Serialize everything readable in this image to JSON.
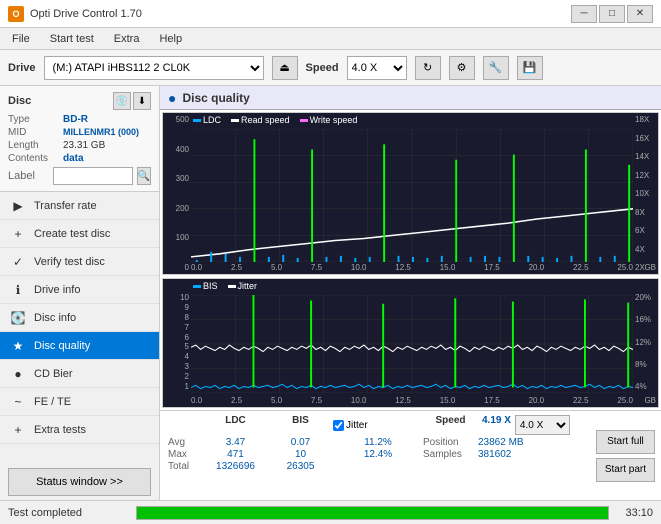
{
  "titlebar": {
    "title": "Opti Drive Control 1.70",
    "icon_label": "O",
    "minimize": "─",
    "maximize": "□",
    "close": "✕"
  },
  "menubar": {
    "items": [
      "File",
      "Start test",
      "Extra",
      "Help"
    ]
  },
  "toolbar": {
    "drive_label": "Drive",
    "drive_value": "(M:) ATAPI iHBS112  2 CL0K",
    "speed_label": "Speed",
    "speed_value": "4.0 X"
  },
  "disc": {
    "section_label": "Disc",
    "type_key": "Type",
    "type_val": "BD-R",
    "mid_key": "MID",
    "mid_val": "MILLENMR1 (000)",
    "length_key": "Length",
    "length_val": "23.31 GB",
    "contents_key": "Contents",
    "contents_val": "data",
    "label_key": "Label",
    "label_val": ""
  },
  "nav": {
    "items": [
      {
        "id": "transfer-rate",
        "label": "Transfer rate",
        "icon": "▶"
      },
      {
        "id": "create-test-disc",
        "label": "Create test disc",
        "icon": "💿"
      },
      {
        "id": "verify-test-disc",
        "label": "Verify test disc",
        "icon": "✓"
      },
      {
        "id": "drive-info",
        "label": "Drive info",
        "icon": "ℹ"
      },
      {
        "id": "disc-info",
        "label": "Disc info",
        "icon": "💽"
      },
      {
        "id": "disc-quality",
        "label": "Disc quality",
        "icon": "★",
        "active": true
      },
      {
        "id": "cd-bier",
        "label": "CD Bier",
        "icon": "🍺"
      },
      {
        "id": "fe-te",
        "label": "FE / TE",
        "icon": "~"
      },
      {
        "id": "extra-tests",
        "label": "Extra tests",
        "icon": "+"
      }
    ],
    "status_window": "Status window >>"
  },
  "content": {
    "header_icon": "●",
    "header_title": "Disc quality",
    "chart_top": {
      "legend": [
        {
          "label": "LDC",
          "color": "#00aaff"
        },
        {
          "label": "Read speed",
          "color": "#ffffff"
        },
        {
          "label": "Write speed",
          "color": "#ff66ff"
        }
      ],
      "y_left": [
        "500",
        "400",
        "300",
        "200",
        "100",
        "0"
      ],
      "y_right": [
        "18X",
        "16X",
        "14X",
        "12X",
        "10X",
        "8X",
        "6X",
        "4X",
        "2X"
      ],
      "x_labels": [
        "0.0",
        "2.5",
        "5.0",
        "7.5",
        "10.0",
        "12.5",
        "15.0",
        "17.5",
        "20.0",
        "22.5",
        "25.0"
      ],
      "x_unit": "GB"
    },
    "chart_bottom": {
      "legend": [
        {
          "label": "BIS",
          "color": "#00aaff"
        },
        {
          "label": "Jitter",
          "color": "#ffffff"
        }
      ],
      "y_left": [
        "10",
        "9",
        "8",
        "7",
        "6",
        "5",
        "4",
        "3",
        "2",
        "1"
      ],
      "y_right": [
        "20%",
        "16%",
        "12%",
        "8%",
        "4%"
      ],
      "x_labels": [
        "0.0",
        "2.5",
        "5.0",
        "7.5",
        "10.0",
        "12.5",
        "15.0",
        "17.5",
        "20.0",
        "22.5",
        "25.0"
      ],
      "x_unit": "GB"
    }
  },
  "stats": {
    "col_headers": [
      "LDC",
      "BIS",
      "",
      "Jitter",
      "Speed"
    ],
    "jitter_checked": true,
    "jitter_label": "Jitter",
    "rows": [
      {
        "label": "Avg",
        "ldc": "3.47",
        "bis": "0.07",
        "jitter": "11.2%",
        "speed_label": "Position",
        "speed_val": "23862 MB"
      },
      {
        "label": "Max",
        "ldc": "471",
        "bis": "10",
        "jitter": "12.4%",
        "speed_label": "Samples",
        "speed_val": "381602"
      },
      {
        "label": "Total",
        "ldc": "1326696",
        "bis": "26305",
        "jitter": "",
        "speed_label": "",
        "speed_val": ""
      }
    ],
    "speed_current": "4.19 X",
    "speed_dropdown": "4.0 X",
    "btn_start_full": "Start full",
    "btn_start_part": "Start part"
  },
  "statusbar": {
    "text": "Test completed",
    "progress": 100,
    "time": "33:10"
  }
}
